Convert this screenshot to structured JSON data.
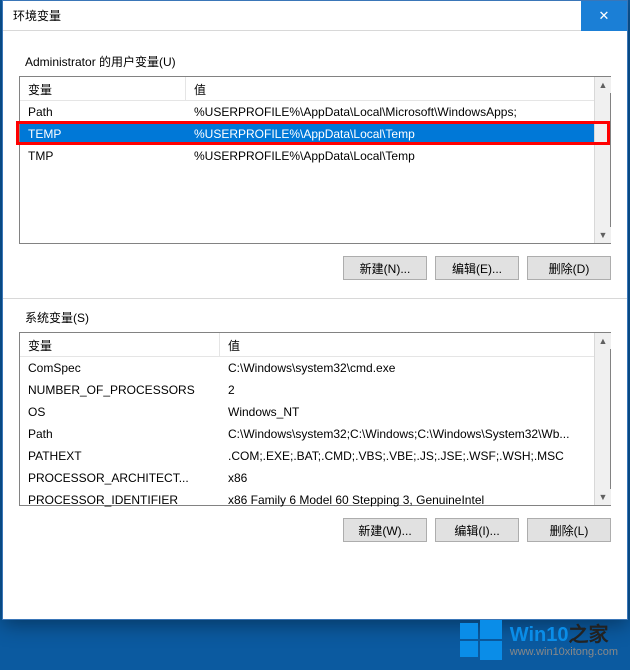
{
  "window": {
    "title": "环境变量",
    "close_icon": "✕"
  },
  "user_section": {
    "label": "Administrator 的用户变量(U)",
    "col_name": "变量",
    "col_value": "值",
    "rows": [
      {
        "name": "Path",
        "value": "%USERPROFILE%\\AppData\\Local\\Microsoft\\WindowsApps;"
      },
      {
        "name": "TEMP",
        "value": "%USERPROFILE%\\AppData\\Local\\Temp"
      },
      {
        "name": "TMP",
        "value": "%USERPROFILE%\\AppData\\Local\\Temp"
      }
    ],
    "selected_index": 1,
    "buttons": {
      "new": "新建(N)...",
      "edit": "编辑(E)...",
      "delete": "删除(D)"
    }
  },
  "system_section": {
    "label": "系统变量(S)",
    "col_name": "变量",
    "col_value": "值",
    "rows": [
      {
        "name": "ComSpec",
        "value": "C:\\Windows\\system32\\cmd.exe"
      },
      {
        "name": "NUMBER_OF_PROCESSORS",
        "value": "2"
      },
      {
        "name": "OS",
        "value": "Windows_NT"
      },
      {
        "name": "Path",
        "value": "C:\\Windows\\system32;C:\\Windows;C:\\Windows\\System32\\Wb..."
      },
      {
        "name": "PATHEXT",
        "value": ".COM;.EXE;.BAT;.CMD;.VBS;.VBE;.JS;.JSE;.WSF;.WSH;.MSC"
      },
      {
        "name": "PROCESSOR_ARCHITECT...",
        "value": "x86"
      },
      {
        "name": "PROCESSOR_IDENTIFIER",
        "value": "x86 Family 6 Model 60 Stepping 3, GenuineIntel"
      }
    ],
    "buttons": {
      "new": "新建(W)...",
      "edit": "编辑(I)...",
      "delete": "删除(L)"
    }
  },
  "watermark": {
    "brand_prefix": "Win10",
    "brand_suffix": "之家",
    "url": "www.win10xitong.com"
  }
}
